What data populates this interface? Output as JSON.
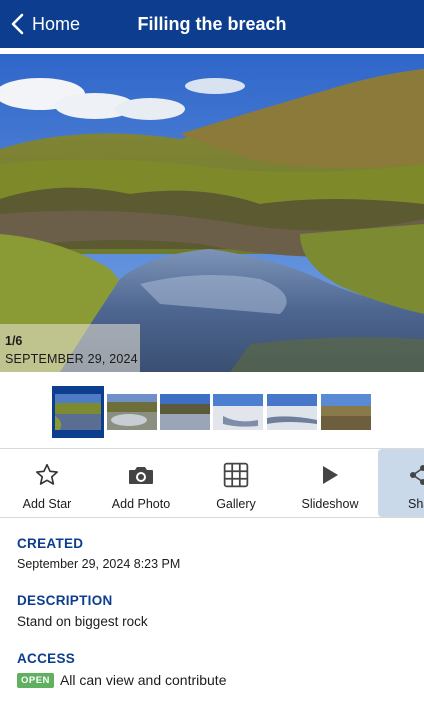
{
  "header": {
    "back_label": "Home",
    "title": "Filling the breach",
    "bar_color": "#0c3d8e"
  },
  "photo": {
    "counter": "1/6",
    "date": "SEPTEMBER 29, 2024",
    "thumbnail_count": 6,
    "selected_index": 0
  },
  "actions": [
    {
      "label": "Add Star",
      "icon": "star-outline-icon"
    },
    {
      "label": "Add Photo",
      "icon": "camera-icon"
    },
    {
      "label": "Gallery",
      "icon": "grid-icon"
    },
    {
      "label": "Slideshow",
      "icon": "play-icon"
    },
    {
      "label": "Share",
      "icon": "share-icon"
    }
  ],
  "details": {
    "created": {
      "title": "CREATED",
      "value": "September 29, 2024 8:23 PM"
    },
    "description": {
      "title": "DESCRIPTION",
      "value": "Stand on biggest rock"
    },
    "access": {
      "title": "ACCESS",
      "badge": "OPEN",
      "badge_color": "#5fb05f",
      "value": "All can view and contribute"
    }
  }
}
